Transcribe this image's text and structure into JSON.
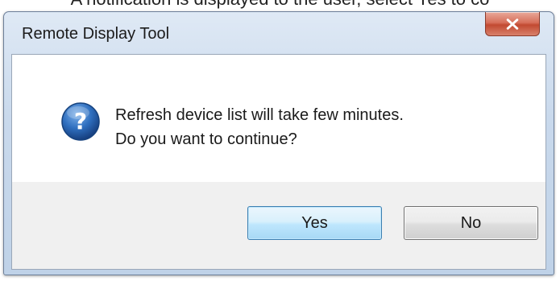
{
  "caption": {
    "text": "A notification is displayed to the user, select Yes to co"
  },
  "dialog": {
    "title": "Remote Display Tool",
    "close_icon": "close-icon",
    "message_icon": "question-icon",
    "message_lines": [
      "Refresh device list will take few minutes.",
      "Do you want to continue?"
    ],
    "buttons": {
      "yes": "Yes",
      "no": "No"
    }
  },
  "colors": {
    "titlebar": "#c9d9ec",
    "close_button": "#c24a31",
    "default_button_border": "#3c7fb1",
    "question_icon": "#1f5fa8"
  }
}
